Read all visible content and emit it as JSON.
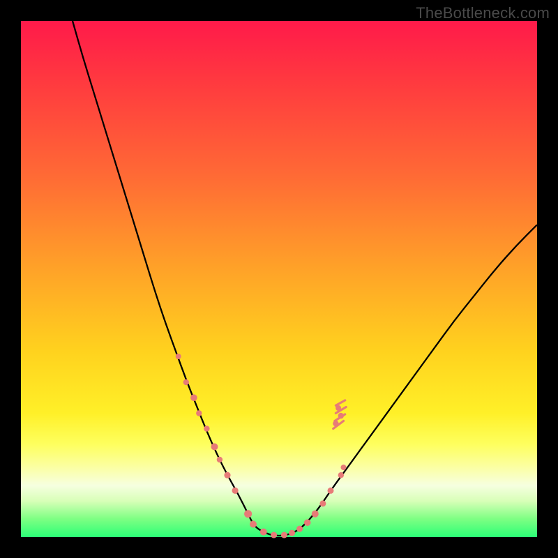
{
  "watermark": "TheBottleneck.com",
  "chart_data": {
    "type": "line",
    "title": "",
    "xlabel": "",
    "ylabel": "",
    "xlim": [
      0,
      100
    ],
    "ylim": [
      0,
      100
    ],
    "curve": {
      "name": "bottleneck-curve",
      "x": [
        10,
        12,
        14,
        16,
        18,
        20,
        22,
        24,
        26,
        28,
        30,
        32,
        34,
        36,
        38,
        40,
        42,
        44,
        45,
        46,
        48,
        50,
        52,
        54,
        56,
        58,
        60,
        64,
        68,
        72,
        76,
        80,
        84,
        88,
        92,
        96,
        100
      ],
      "y": [
        100,
        93,
        86.5,
        80,
        73.5,
        67,
        60.5,
        54,
        47.5,
        41.5,
        36,
        30.5,
        25.5,
        20.5,
        16,
        12,
        8.5,
        4.5,
        2.5,
        1.5,
        0.5,
        0.2,
        0.5,
        1.5,
        3.5,
        6,
        9,
        14.5,
        20,
        25.5,
        31,
        36.5,
        42,
        47,
        52,
        56.5,
        60.5
      ]
    },
    "scatter": {
      "name": "scatter-points",
      "color": "#e77b77",
      "points": [
        {
          "x": 30.5,
          "y": 35.0,
          "r": 4.0
        },
        {
          "x": 32.0,
          "y": 30.0,
          "r": 4.2
        },
        {
          "x": 33.5,
          "y": 27.0,
          "r": 4.8
        },
        {
          "x": 34.5,
          "y": 24.0,
          "r": 4.2
        },
        {
          "x": 36.0,
          "y": 21.0,
          "r": 4.2
        },
        {
          "x": 37.5,
          "y": 17.5,
          "r": 5.0
        },
        {
          "x": 38.5,
          "y": 15.0,
          "r": 4.2
        },
        {
          "x": 40.0,
          "y": 12.0,
          "r": 4.6
        },
        {
          "x": 41.5,
          "y": 9.0,
          "r": 4.6
        },
        {
          "x": 44.0,
          "y": 4.5,
          "r": 5.5
        },
        {
          "x": 45.0,
          "y": 2.5,
          "r": 5.0
        },
        {
          "x": 47.0,
          "y": 1.0,
          "r": 5.0
        },
        {
          "x": 49.0,
          "y": 0.4,
          "r": 4.5
        },
        {
          "x": 51.0,
          "y": 0.4,
          "r": 4.5
        },
        {
          "x": 52.5,
          "y": 0.8,
          "r": 4.5
        },
        {
          "x": 54.0,
          "y": 1.6,
          "r": 4.5
        },
        {
          "x": 55.5,
          "y": 2.8,
          "r": 4.8
        },
        {
          "x": 57.0,
          "y": 4.5,
          "r": 5.0
        },
        {
          "x": 58.5,
          "y": 6.5,
          "r": 4.5
        },
        {
          "x": 60.0,
          "y": 9.0,
          "r": 4.5
        },
        {
          "x": 62.0,
          "y": 12.0,
          "r": 4.2
        },
        {
          "x": 62.5,
          "y": 13.5,
          "r": 4.0
        },
        {
          "x": 61.0,
          "y": 22.0,
          "r": 4.2
        },
        {
          "x": 62.0,
          "y": 23.5,
          "r": 4.2
        },
        {
          "x": 61.5,
          "y": 25.0,
          "r": 4.0
        }
      ]
    },
    "fuzz_marks": {
      "name": "fuzz-strokes",
      "color": "#e77b77",
      "strokes": [
        {
          "x1": 60.5,
          "y1": 21.0,
          "x2": 62.5,
          "y2": 22.5
        },
        {
          "x1": 60.8,
          "y1": 22.5,
          "x2": 62.8,
          "y2": 23.8
        },
        {
          "x1": 61.0,
          "y1": 24.0,
          "x2": 63.0,
          "y2": 25.2
        },
        {
          "x1": 61.0,
          "y1": 25.5,
          "x2": 62.8,
          "y2": 26.5
        }
      ]
    }
  }
}
